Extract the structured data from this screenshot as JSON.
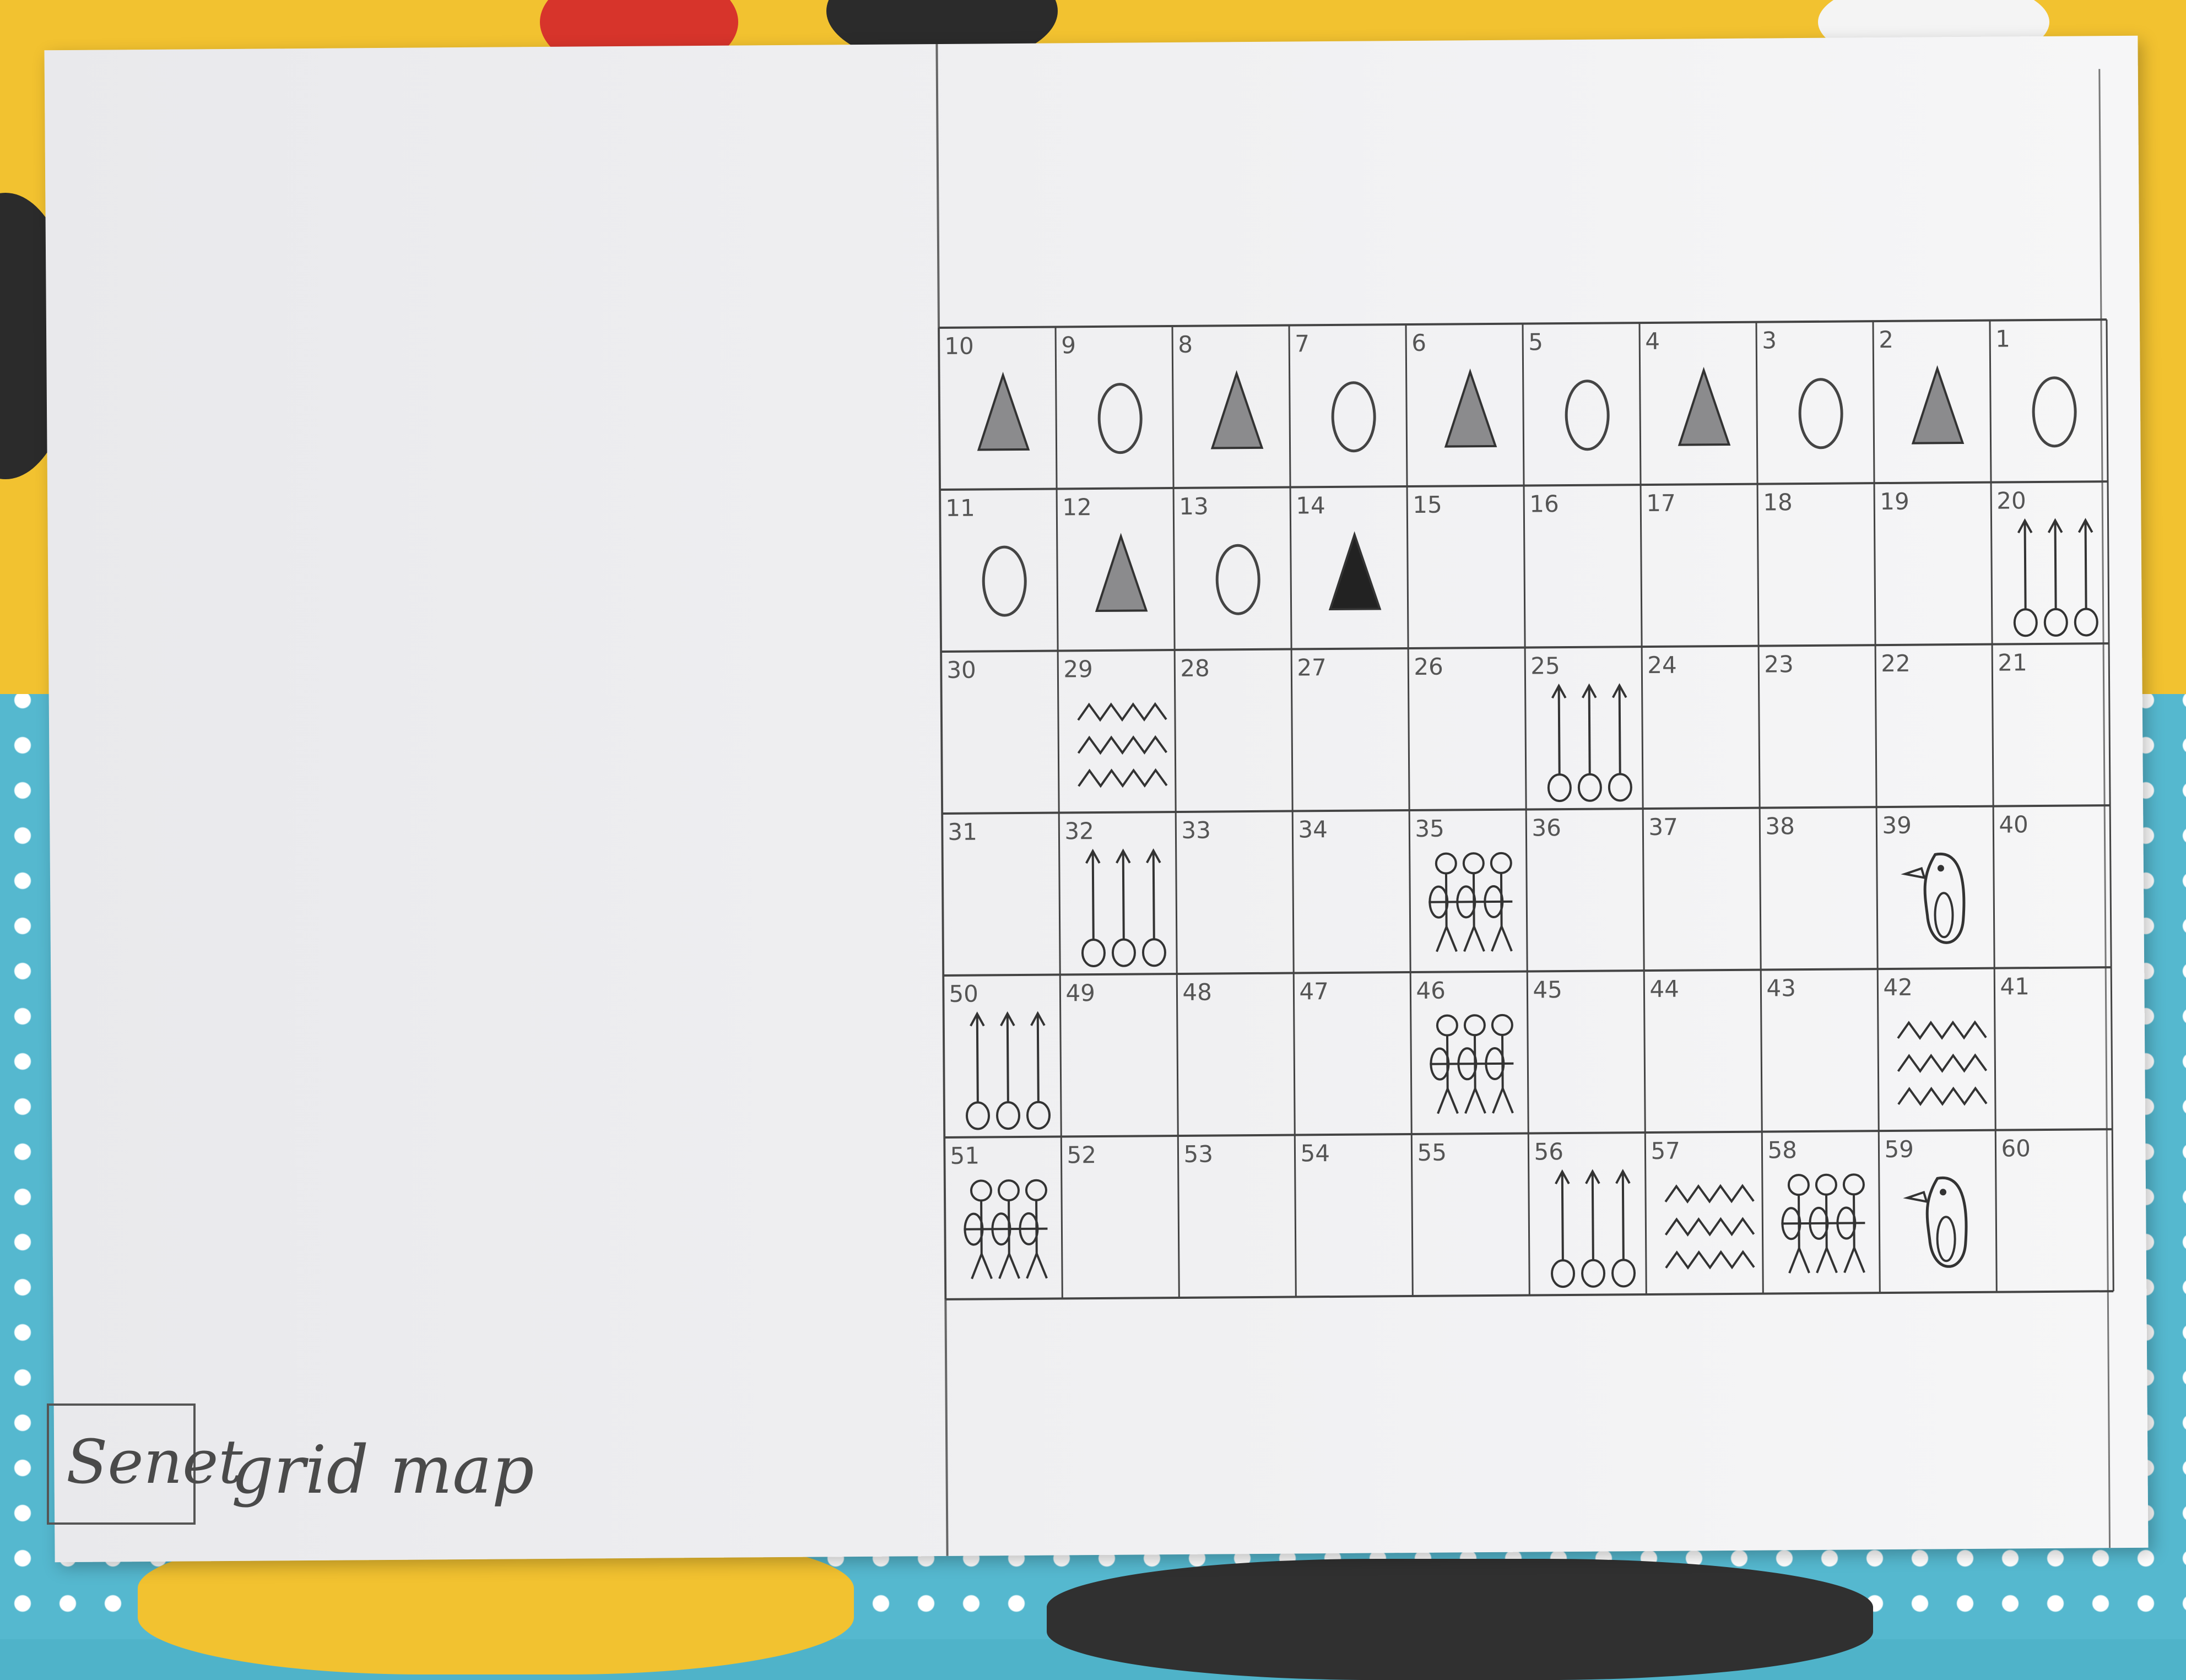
{
  "title": "Senet",
  "subtitle": "grid map",
  "colors": {
    "pencil": "#444444",
    "paper": "#efeff1",
    "cloth_blue": "#55b8cf",
    "cloth_yellow": "#f2c230"
  },
  "rows": [
    [
      {
        "n": "10",
        "sym": "cone"
      },
      {
        "n": "9",
        "sym": "oval"
      },
      {
        "n": "8",
        "sym": "cone"
      },
      {
        "n": "7",
        "sym": "oval"
      },
      {
        "n": "6",
        "sym": "cone"
      },
      {
        "n": "5",
        "sym": "oval"
      },
      {
        "n": "4",
        "sym": "cone"
      },
      {
        "n": "3",
        "sym": "oval"
      },
      {
        "n": "2",
        "sym": "cone"
      },
      {
        "n": "1",
        "sym": "oval"
      }
    ],
    [
      {
        "n": "11",
        "sym": "oval"
      },
      {
        "n": "12",
        "sym": "cone"
      },
      {
        "n": "13",
        "sym": "oval"
      },
      {
        "n": "14",
        "sym": "cone-dark"
      },
      {
        "n": "15",
        "sym": ""
      },
      {
        "n": "16",
        "sym": ""
      },
      {
        "n": "17",
        "sym": ""
      },
      {
        "n": "18",
        "sym": ""
      },
      {
        "n": "19",
        "sym": ""
      },
      {
        "n": "20",
        "sym": "ankh3"
      }
    ],
    [
      {
        "n": "30",
        "sym": ""
      },
      {
        "n": "29",
        "sym": "water"
      },
      {
        "n": "28",
        "sym": ""
      },
      {
        "n": "27",
        "sym": ""
      },
      {
        "n": "26",
        "sym": ""
      },
      {
        "n": "25",
        "sym": "ankh3"
      },
      {
        "n": "24",
        "sym": ""
      },
      {
        "n": "23",
        "sym": ""
      },
      {
        "n": "22",
        "sym": ""
      },
      {
        "n": "21",
        "sym": ""
      }
    ],
    [
      {
        "n": "31",
        "sym": ""
      },
      {
        "n": "32",
        "sym": "ankh3"
      },
      {
        "n": "33",
        "sym": ""
      },
      {
        "n": "34",
        "sym": ""
      },
      {
        "n": "35",
        "sym": "people"
      },
      {
        "n": "36",
        "sym": ""
      },
      {
        "n": "37",
        "sym": ""
      },
      {
        "n": "38",
        "sym": ""
      },
      {
        "n": "39",
        "sym": "bird"
      },
      {
        "n": "40",
        "sym": ""
      }
    ],
    [
      {
        "n": "50",
        "sym": "ankh3"
      },
      {
        "n": "49",
        "sym": ""
      },
      {
        "n": "48",
        "sym": ""
      },
      {
        "n": "47",
        "sym": ""
      },
      {
        "n": "46",
        "sym": "people"
      },
      {
        "n": "45",
        "sym": ""
      },
      {
        "n": "44",
        "sym": ""
      },
      {
        "n": "43",
        "sym": ""
      },
      {
        "n": "42",
        "sym": "water"
      },
      {
        "n": "41",
        "sym": ""
      }
    ],
    [
      {
        "n": "51",
        "sym": "people"
      },
      {
        "n": "52",
        "sym": ""
      },
      {
        "n": "53",
        "sym": ""
      },
      {
        "n": "54",
        "sym": ""
      },
      {
        "n": "55",
        "sym": ""
      },
      {
        "n": "56",
        "sym": "ankh3"
      },
      {
        "n": "57",
        "sym": "water"
      },
      {
        "n": "58",
        "sym": "people"
      },
      {
        "n": "59",
        "sym": "bird"
      },
      {
        "n": "60",
        "sym": ""
      }
    ]
  ]
}
